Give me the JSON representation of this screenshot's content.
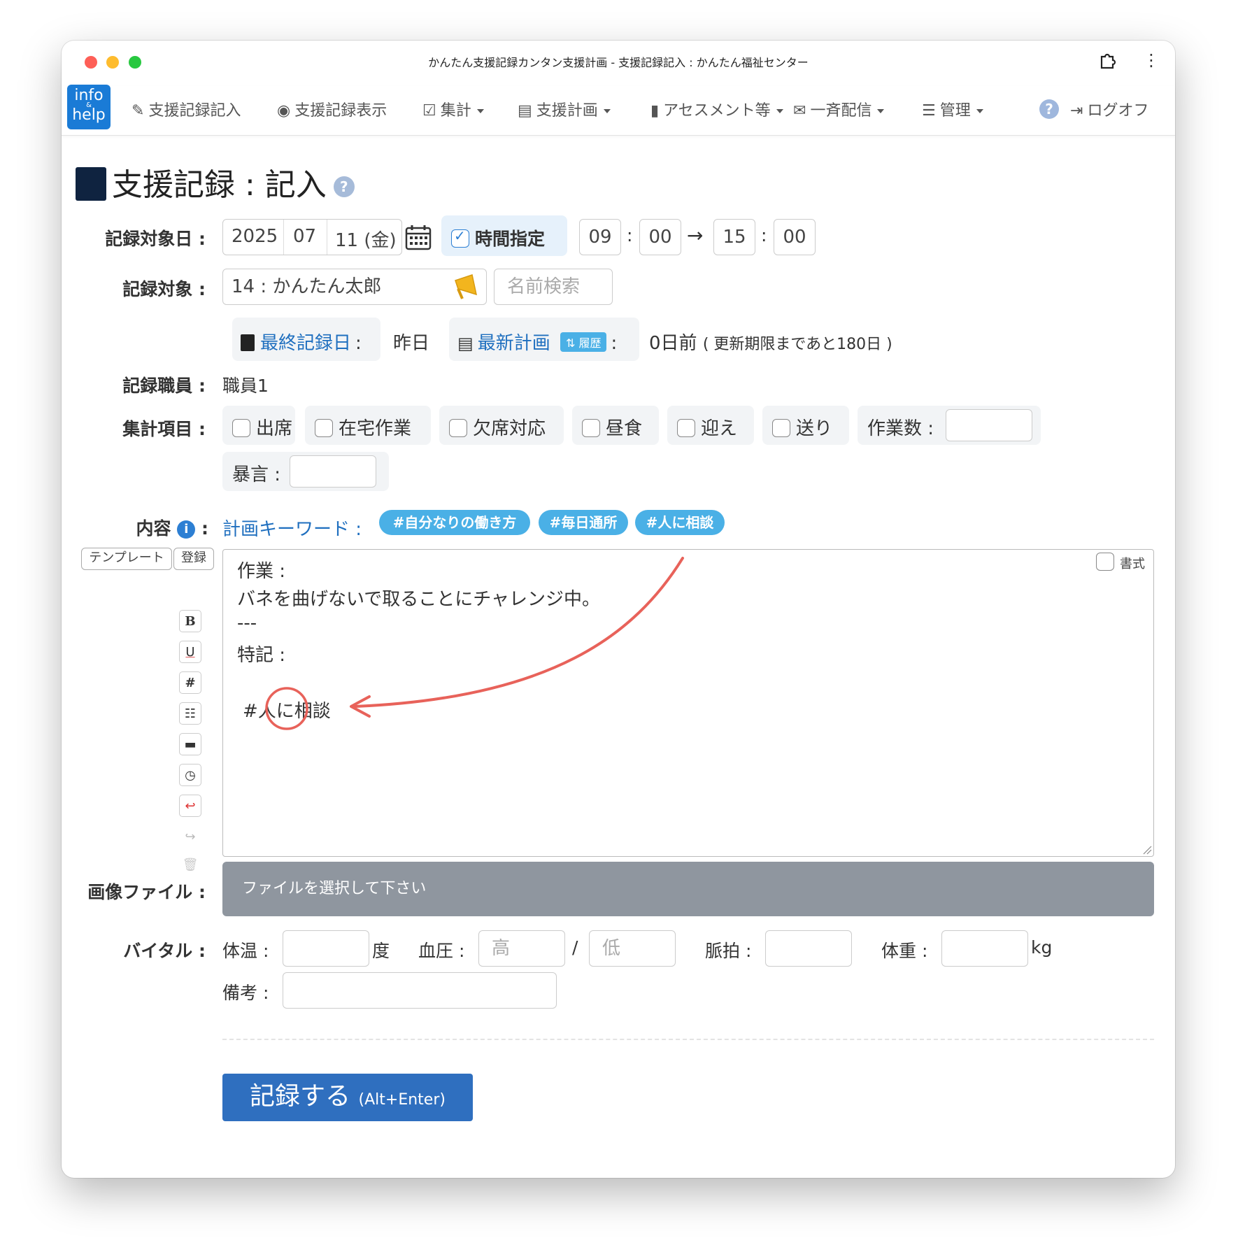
{
  "window": {
    "title": "かんたん支援記録カンタン支援計画 - 支援記録記入 : かんたん福祉センター"
  },
  "nav": {
    "logo_top": "info",
    "logo_amp": "&",
    "logo_bottom": "help",
    "items": [
      {
        "label": "支援記録記入",
        "icon": "pencil-icon"
      },
      {
        "label": "支援記録表示",
        "icon": "eye-icon"
      },
      {
        "label": "集計",
        "icon": "check-square-icon"
      },
      {
        "label": "支援計画",
        "icon": "list-icon"
      },
      {
        "label": "アセスメント等",
        "icon": "file-icon"
      },
      {
        "label": "一斉配信",
        "icon": "envelope-icon"
      },
      {
        "label": "管理",
        "icon": "list-ul-icon"
      }
    ],
    "help": "?",
    "logoff": "ログオフ"
  },
  "page": {
    "title": "支援記録 : 記入",
    "help": "?"
  },
  "date_row": {
    "label": "記録対象日 :",
    "year": "2025",
    "month": "07",
    "day": "11 (金)",
    "time_toggle": "時間指定",
    "time_toggle_checked": true,
    "start_hour": "09",
    "start_min": "00",
    "arrow": "→",
    "end_hour": "15",
    "end_min": "00",
    "colon": ":"
  },
  "target_row": {
    "label": "記録対象 :",
    "value": "14 : かんたん太郎",
    "search_placeholder": "名前検索"
  },
  "info_row": {
    "last_record_label": "最終記録日",
    "last_record_value": "昨日",
    "latest_plan_label": "最新計画",
    "history_badge": "履歴",
    "plan_value": "0日前",
    "plan_note": "( 更新期限まであと180日 )",
    "colon": ":"
  },
  "staff_row": {
    "label": "記録職員 :",
    "value": "職員1"
  },
  "summary_row": {
    "label": "集計項目 :",
    "checks": [
      "出席",
      "在宅作業",
      "欠席対応",
      "昼食",
      "迎え",
      "送り"
    ],
    "work_count_label": "作業数 :",
    "abuse_label": "暴言 :"
  },
  "content_row": {
    "label": "内容",
    "colon": ":",
    "keyword_label": "計画キーワード :",
    "tags": [
      "#自分なりの働き方",
      "#毎日通所",
      "#人に相談"
    ],
    "template_btn": "テンプレート",
    "register_btn": "登録",
    "format_label": "書式",
    "lines": [
      "作業 :",
      "バネを曲げないで取ることにチャレンジ中。",
      "---",
      "特記 :",
      "#人に相談"
    ],
    "tools": [
      "B",
      "U",
      "#"
    ]
  },
  "image_row": {
    "label": "画像ファイル :",
    "placeholder": "ファイルを選択して下さい"
  },
  "vital_row": {
    "label": "バイタル :",
    "temp_label": "体温 :",
    "temp_unit": "度",
    "bp_label": "血圧 :",
    "bp_high_placeholder": "高",
    "bp_sep": "/",
    "bp_low_placeholder": "低",
    "pulse_label": "脈拍 :",
    "weight_label": "体重 :",
    "weight_unit": "kg",
    "note_label": "備考 :"
  },
  "submit": {
    "label": "記録する",
    "shortcut": "(Alt+Enter)"
  },
  "colors": {
    "accent": "#2f6fbf",
    "tag": "#4ab0e6",
    "annotation": "#e8625a",
    "file_bar": "#8f969f"
  }
}
